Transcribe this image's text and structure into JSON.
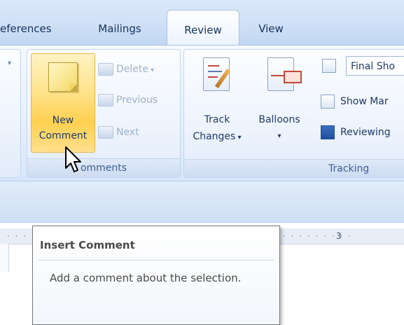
{
  "tabs": [
    "eferences",
    "Mailings",
    "Review",
    "View"
  ],
  "active_tab": "Review",
  "comments_group": {
    "new_comment_line1": "New",
    "new_comment_line2": "Comment",
    "delete_label": "Delete",
    "previous_label": "Previous",
    "next_label": "Next",
    "group_label": "omments"
  },
  "tracking_group": {
    "track_changes_line1": "Track",
    "track_changes_line2": "Changes",
    "balloons_label": "Balloons",
    "final_show_value": "Final Sho",
    "show_markup_label": "Show Mar",
    "reviewing_label": "Reviewing",
    "group_label": "Tracking"
  },
  "ruler": {
    "text": "· · · · · · · · ·",
    "number": "3"
  },
  "tooltip": {
    "title": "Insert Comment",
    "description": "Add a comment about the selection."
  },
  "colors": {
    "accent_hover": "#ffd04f",
    "ribbon_bg": "#e7f0fc",
    "text_primary": "#1e3a66"
  },
  "icons": {
    "new_comment": "sticky-note-icon",
    "delete": "delete-comment-icon",
    "previous": "previous-comment-icon",
    "next": "next-comment-icon",
    "track_changes": "track-changes-icon",
    "balloons": "balloons-icon",
    "final_show": "display-for-review-icon",
    "show_markup": "show-markup-icon",
    "reviewing_pane": "reviewing-pane-icon",
    "cursor": "mouse-pointer-icon"
  }
}
